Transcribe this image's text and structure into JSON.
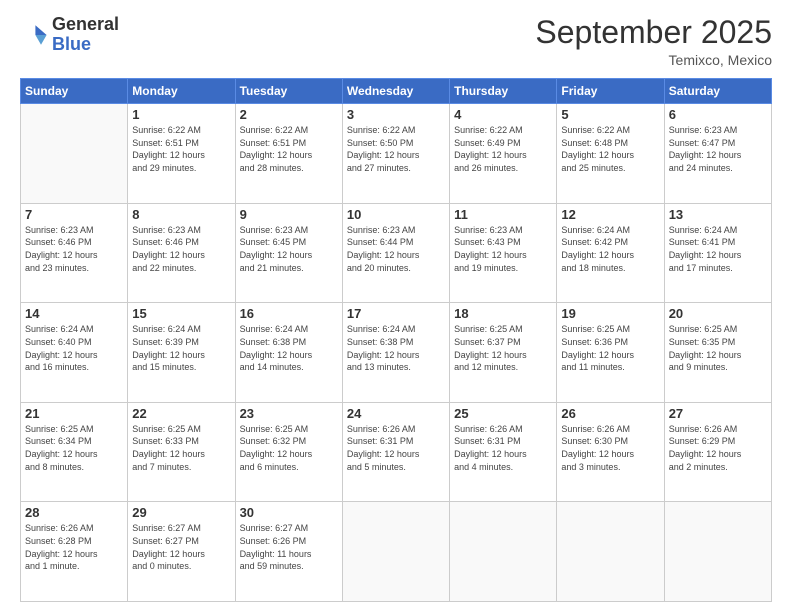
{
  "header": {
    "logo_line1": "General",
    "logo_line2": "Blue",
    "month": "September 2025",
    "location": "Temixco, Mexico"
  },
  "days_of_week": [
    "Sunday",
    "Monday",
    "Tuesday",
    "Wednesday",
    "Thursday",
    "Friday",
    "Saturday"
  ],
  "weeks": [
    [
      {
        "num": "",
        "info": ""
      },
      {
        "num": "1",
        "info": "Sunrise: 6:22 AM\nSunset: 6:51 PM\nDaylight: 12 hours\nand 29 minutes."
      },
      {
        "num": "2",
        "info": "Sunrise: 6:22 AM\nSunset: 6:51 PM\nDaylight: 12 hours\nand 28 minutes."
      },
      {
        "num": "3",
        "info": "Sunrise: 6:22 AM\nSunset: 6:50 PM\nDaylight: 12 hours\nand 27 minutes."
      },
      {
        "num": "4",
        "info": "Sunrise: 6:22 AM\nSunset: 6:49 PM\nDaylight: 12 hours\nand 26 minutes."
      },
      {
        "num": "5",
        "info": "Sunrise: 6:22 AM\nSunset: 6:48 PM\nDaylight: 12 hours\nand 25 minutes."
      },
      {
        "num": "6",
        "info": "Sunrise: 6:23 AM\nSunset: 6:47 PM\nDaylight: 12 hours\nand 24 minutes."
      }
    ],
    [
      {
        "num": "7",
        "info": "Sunrise: 6:23 AM\nSunset: 6:46 PM\nDaylight: 12 hours\nand 23 minutes."
      },
      {
        "num": "8",
        "info": "Sunrise: 6:23 AM\nSunset: 6:46 PM\nDaylight: 12 hours\nand 22 minutes."
      },
      {
        "num": "9",
        "info": "Sunrise: 6:23 AM\nSunset: 6:45 PM\nDaylight: 12 hours\nand 21 minutes."
      },
      {
        "num": "10",
        "info": "Sunrise: 6:23 AM\nSunset: 6:44 PM\nDaylight: 12 hours\nand 20 minutes."
      },
      {
        "num": "11",
        "info": "Sunrise: 6:23 AM\nSunset: 6:43 PM\nDaylight: 12 hours\nand 19 minutes."
      },
      {
        "num": "12",
        "info": "Sunrise: 6:24 AM\nSunset: 6:42 PM\nDaylight: 12 hours\nand 18 minutes."
      },
      {
        "num": "13",
        "info": "Sunrise: 6:24 AM\nSunset: 6:41 PM\nDaylight: 12 hours\nand 17 minutes."
      }
    ],
    [
      {
        "num": "14",
        "info": "Sunrise: 6:24 AM\nSunset: 6:40 PM\nDaylight: 12 hours\nand 16 minutes."
      },
      {
        "num": "15",
        "info": "Sunrise: 6:24 AM\nSunset: 6:39 PM\nDaylight: 12 hours\nand 15 minutes."
      },
      {
        "num": "16",
        "info": "Sunrise: 6:24 AM\nSunset: 6:38 PM\nDaylight: 12 hours\nand 14 minutes."
      },
      {
        "num": "17",
        "info": "Sunrise: 6:24 AM\nSunset: 6:38 PM\nDaylight: 12 hours\nand 13 minutes."
      },
      {
        "num": "18",
        "info": "Sunrise: 6:25 AM\nSunset: 6:37 PM\nDaylight: 12 hours\nand 12 minutes."
      },
      {
        "num": "19",
        "info": "Sunrise: 6:25 AM\nSunset: 6:36 PM\nDaylight: 12 hours\nand 11 minutes."
      },
      {
        "num": "20",
        "info": "Sunrise: 6:25 AM\nSunset: 6:35 PM\nDaylight: 12 hours\nand 9 minutes."
      }
    ],
    [
      {
        "num": "21",
        "info": "Sunrise: 6:25 AM\nSunset: 6:34 PM\nDaylight: 12 hours\nand 8 minutes."
      },
      {
        "num": "22",
        "info": "Sunrise: 6:25 AM\nSunset: 6:33 PM\nDaylight: 12 hours\nand 7 minutes."
      },
      {
        "num": "23",
        "info": "Sunrise: 6:25 AM\nSunset: 6:32 PM\nDaylight: 12 hours\nand 6 minutes."
      },
      {
        "num": "24",
        "info": "Sunrise: 6:26 AM\nSunset: 6:31 PM\nDaylight: 12 hours\nand 5 minutes."
      },
      {
        "num": "25",
        "info": "Sunrise: 6:26 AM\nSunset: 6:31 PM\nDaylight: 12 hours\nand 4 minutes."
      },
      {
        "num": "26",
        "info": "Sunrise: 6:26 AM\nSunset: 6:30 PM\nDaylight: 12 hours\nand 3 minutes."
      },
      {
        "num": "27",
        "info": "Sunrise: 6:26 AM\nSunset: 6:29 PM\nDaylight: 12 hours\nand 2 minutes."
      }
    ],
    [
      {
        "num": "28",
        "info": "Sunrise: 6:26 AM\nSunset: 6:28 PM\nDaylight: 12 hours\nand 1 minute."
      },
      {
        "num": "29",
        "info": "Sunrise: 6:27 AM\nSunset: 6:27 PM\nDaylight: 12 hours\nand 0 minutes."
      },
      {
        "num": "30",
        "info": "Sunrise: 6:27 AM\nSunset: 6:26 PM\nDaylight: 11 hours\nand 59 minutes."
      },
      {
        "num": "",
        "info": ""
      },
      {
        "num": "",
        "info": ""
      },
      {
        "num": "",
        "info": ""
      },
      {
        "num": "",
        "info": ""
      }
    ]
  ]
}
